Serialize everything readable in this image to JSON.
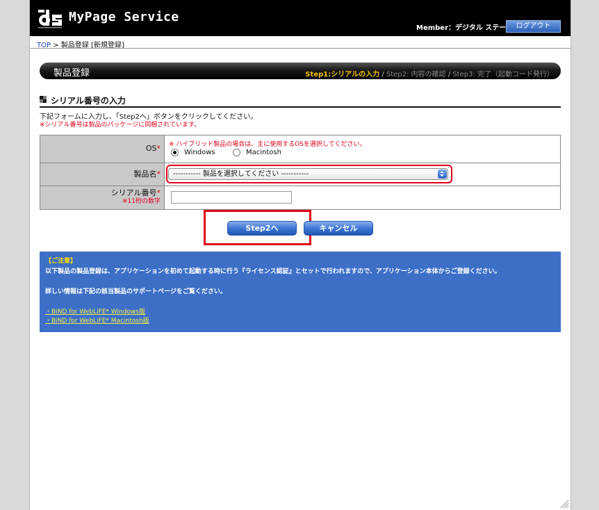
{
  "header": {
    "logo_mark": "ds",
    "brand": "MyPage Service",
    "member_label": "Member：デジタル ステージ",
    "logout_label": "ログアウト"
  },
  "breadcrumb": {
    "top_link": "TOP",
    "separator": ">",
    "current": "製品登録 [新規登録]"
  },
  "title_bar": {
    "title": "製品登録",
    "steps": [
      {
        "label": "Step1:シリアルの入力",
        "current": true
      },
      {
        "label": "Step2: 内容の確認",
        "current": false
      },
      {
        "label": "Step3: 完了（起動コード発行）",
        "current": false
      }
    ],
    "step_separator": "/"
  },
  "section": {
    "title": "シリアル番号の入力",
    "instruction": "下記フォームに入力し、「Step2へ」ボタンをクリックしてください。",
    "note": "※シリアル番号は製品のパッケージに同梱されています。"
  },
  "form": {
    "os": {
      "label": "OS",
      "required_mark": "*",
      "note": "※ ハイブリッド製品の場合は、主に使用するOSを選択してください。",
      "options": [
        {
          "label": "Windows",
          "selected": true
        },
        {
          "label": "Macintosh",
          "selected": false
        }
      ]
    },
    "product": {
      "label": "製品名",
      "required_mark": "*",
      "selected_value": "----------- 製品を選択してください -----------"
    },
    "serial": {
      "label": "シリアル番号",
      "required_mark": "*",
      "sublabel": "※11桁の数字",
      "value": ""
    }
  },
  "buttons": {
    "next": "Step2へ",
    "cancel": "キャンセル"
  },
  "notice": {
    "title": "【ご注意】",
    "line1": "以下製品の製品登録は、アプリケーションを初めて起動する時に行う『ライセンス認証』とセットで行われますので、アプリケーション本体からご登録ください。",
    "line2": "詳しい情報は下記の該当製品のサポートページをご覧ください。",
    "links": [
      "・BiND for WebLiFE* Windows版",
      "・BiND for WebLiFE* Macintosh版"
    ]
  },
  "colors": {
    "accent_blue": "#3d6fc7",
    "required_red": "#e0001a",
    "step_current": "#f6c400",
    "header_bg": "#000000"
  }
}
